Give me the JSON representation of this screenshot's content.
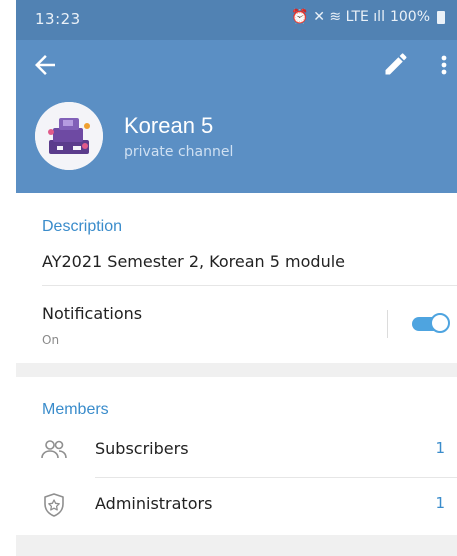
{
  "status_bar": {
    "time": "13:23",
    "icons_text": "⏰ ✕ ≋ LTE ıll",
    "battery": "100%"
  },
  "header": {
    "channel_name": "Korean 5",
    "channel_type": "private channel",
    "accent_color": "#5b8fc4"
  },
  "description": {
    "label": "Description",
    "text": "AY2021 Semester 2, Korean 5 module"
  },
  "notifications": {
    "label": "Notifications",
    "status": "On",
    "enabled": true
  },
  "members": {
    "label": "Members",
    "rows": [
      {
        "label": "Subscribers",
        "count": "1",
        "icon": "people-icon"
      },
      {
        "label": "Administrators",
        "count": "1",
        "icon": "shield-star-icon"
      }
    ]
  },
  "colors": {
    "link_blue": "#3a8ccb",
    "toggle_blue": "#4ea4e0"
  }
}
